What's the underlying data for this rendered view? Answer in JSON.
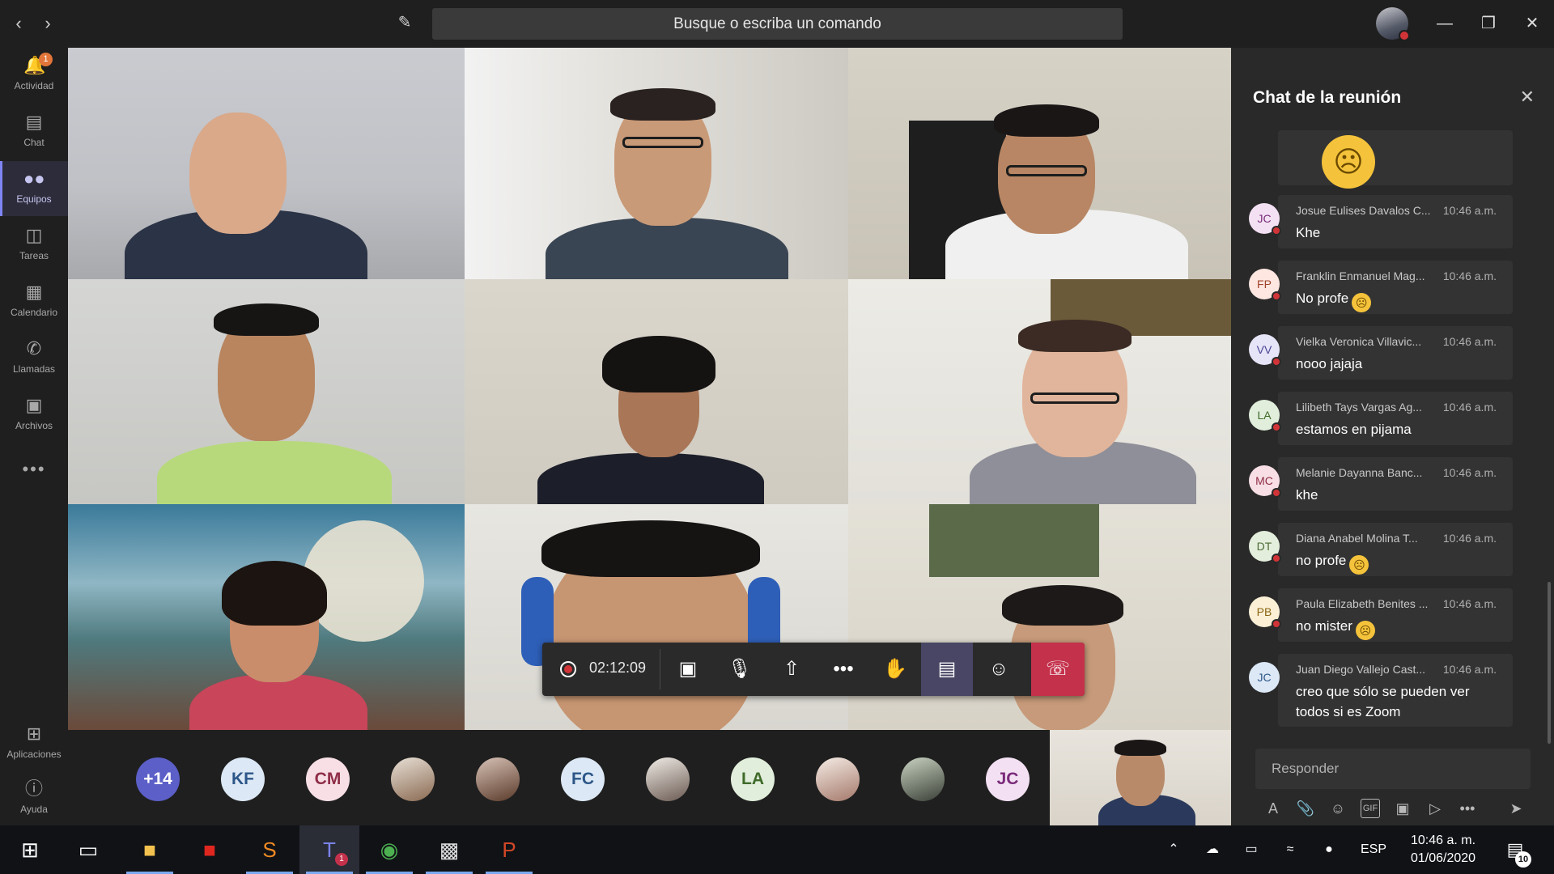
{
  "titlebar": {
    "search_placeholder": "Busque o escriba un comando",
    "back_icon": "chevron-left-icon",
    "forward_icon": "chevron-right-icon"
  },
  "rail": {
    "items": [
      {
        "label": "Actividad",
        "icon": "bell-icon",
        "badge": "1"
      },
      {
        "label": "Chat",
        "icon": "chat-icon"
      },
      {
        "label": "Equipos",
        "icon": "teams-icon",
        "active": true
      },
      {
        "label": "Tareas",
        "icon": "clipboard-icon"
      },
      {
        "label": "Calendario",
        "icon": "calendar-icon"
      },
      {
        "label": "Llamadas",
        "icon": "phone-icon"
      },
      {
        "label": "Archivos",
        "icon": "files-icon"
      }
    ],
    "bottom": [
      {
        "label": "Aplicaciones",
        "icon": "apps-icon"
      },
      {
        "label": "Ayuda",
        "icon": "help-icon"
      }
    ]
  },
  "meeting": {
    "timer": "02:12:09"
  },
  "roster": [
    {
      "initials": "+14",
      "bg": "#5b5fc7",
      "fg": "#ffffff"
    },
    {
      "initials": "KF",
      "bg": "#dce8f5",
      "fg": "#2c5688"
    },
    {
      "initials": "CM",
      "bg": "#f7dfe5",
      "fg": "#8f2d47"
    },
    {
      "initials": "",
      "photo": true
    },
    {
      "initials": "",
      "photo": true
    },
    {
      "initials": "FC",
      "bg": "#dce8f5",
      "fg": "#2c5688"
    },
    {
      "initials": "",
      "photo": true
    },
    {
      "initials": "LA",
      "bg": "#e1eedb",
      "fg": "#3f6b2a"
    },
    {
      "initials": "",
      "photo": true
    },
    {
      "initials": "",
      "photo": true
    },
    {
      "initials": "JC",
      "bg": "#f3e1f3",
      "fg": "#7a2b7a"
    }
  ],
  "chat": {
    "title": "Chat de la reunión",
    "reply_placeholder": "Responder",
    "messages": [
      {
        "initials": "JC",
        "name": "Josue Eulises Davalos C...",
        "time": "10:46 a.m.",
        "text": "Khe",
        "avatar_bg": "#f3e1f3",
        "avatar_fg": "#7a2b7a",
        "emoji": false
      },
      {
        "initials": "FP",
        "name": "Franklin Enmanuel Mag...",
        "time": "10:46 a.m.",
        "text": "No profe",
        "avatar_bg": "#fde7e0",
        "avatar_fg": "#a0432a",
        "emoji": true
      },
      {
        "initials": "VV",
        "name": "Vielka Veronica Villavic...",
        "time": "10:46 a.m.",
        "text": "nooo jajaja",
        "avatar_bg": "#e6e4f7",
        "avatar_fg": "#4b4797",
        "emoji": false
      },
      {
        "initials": "LA",
        "name": "Lilibeth Tays Vargas Ag...",
        "time": "10:46 a.m.",
        "text": "estamos en pijama",
        "avatar_bg": "#e1eedb",
        "avatar_fg": "#3f6b2a",
        "emoji": false
      },
      {
        "initials": "MC",
        "name": "Melanie Dayanna Banc...",
        "time": "10:46 a.m.",
        "text": "khe",
        "avatar_bg": "#f7dfe5",
        "avatar_fg": "#8f2d47",
        "emoji": false
      },
      {
        "initials": "DT",
        "name": "Diana Anabel Molina T...",
        "time": "10:46 a.m.",
        "text": "no profe",
        "avatar_bg": "#e4eedd",
        "avatar_fg": "#4c6b34",
        "emoji": true
      },
      {
        "initials": "PB",
        "name": "Paula Elizabeth Benites ...",
        "time": "10:46 a.m.",
        "text": "no mister",
        "avatar_bg": "#fbf0d6",
        "avatar_fg": "#8a6512",
        "emoji": true
      },
      {
        "initials": "JC",
        "name": "Juan Diego Vallejo Cast...",
        "time": "10:46 a.m.",
        "text": "creo que sólo se pueden ver todos si es Zoom",
        "avatar_bg": "#dce8f5",
        "avatar_fg": "#2c5688",
        "emoji": false
      }
    ]
  },
  "taskbar": {
    "language": "ESP",
    "time": "10:46 a. m.",
    "date": "01/06/2020",
    "notifications": "10",
    "teams_badge": "1"
  }
}
